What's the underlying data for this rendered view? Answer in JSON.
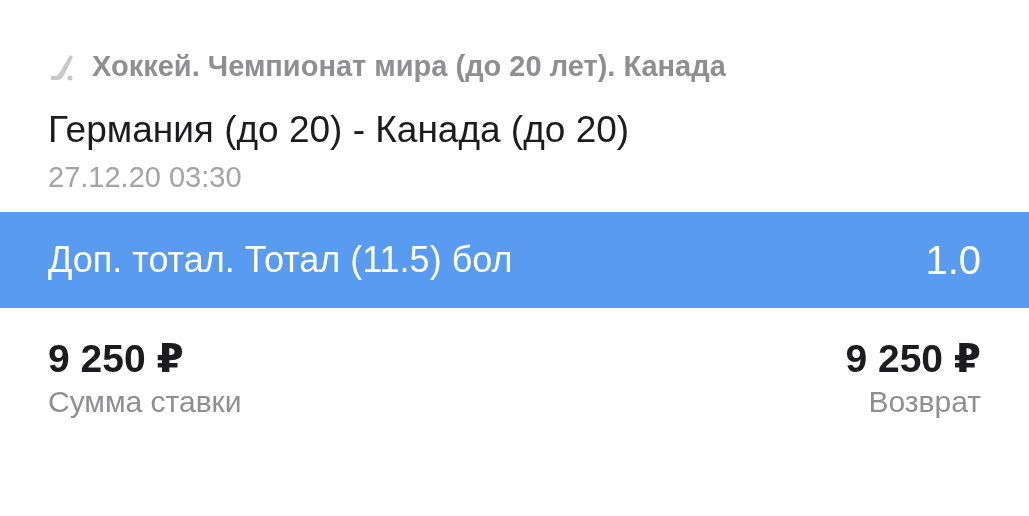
{
  "event": {
    "category": "Хоккей. Чемпионат мира (до 20 лет). Канада",
    "match": "Германия (до 20) - Канада (до 20)",
    "datetime": "27.12.20 03:30"
  },
  "selection": {
    "market": "Доп. тотал. Тотал (11.5) бол",
    "odds": "1.0"
  },
  "amounts": [
    {
      "value": "9 250 ₽",
      "label": "Сумма ставки"
    },
    {
      "value": "9 250 ₽",
      "label": "Возврат"
    }
  ]
}
